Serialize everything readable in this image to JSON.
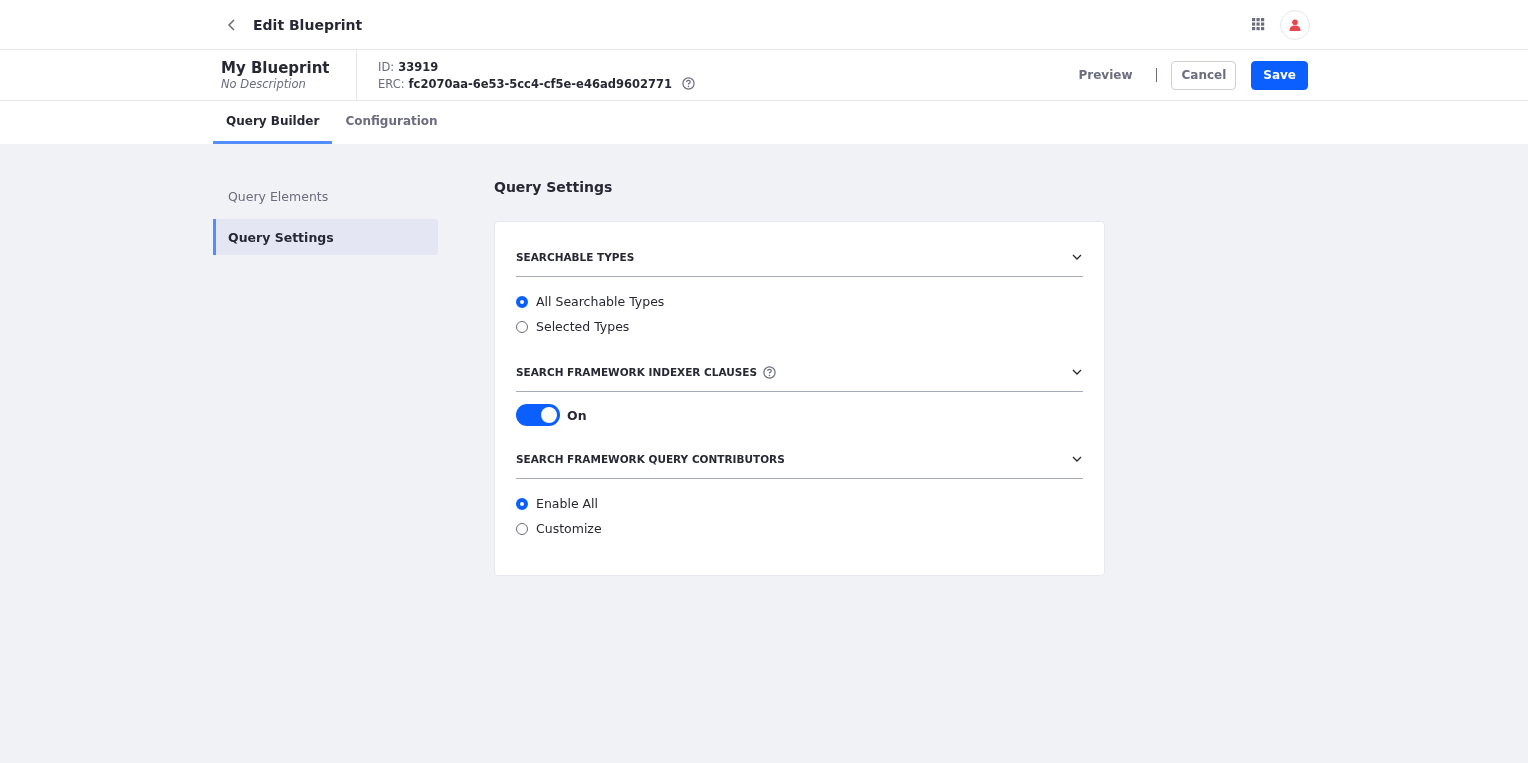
{
  "top_bar": {
    "title": "Edit Blueprint"
  },
  "header": {
    "name": "My Blueprint",
    "description": "No Description",
    "id_label": "ID:",
    "id_value": "33919",
    "erc_label": "ERC:",
    "erc_value": "fc2070aa-6e53-5cc4-cf5e-e46ad9602771",
    "preview": "Preview",
    "cancel": "Cancel",
    "save": "Save"
  },
  "tabs": [
    {
      "label": "Query Builder",
      "selected": true
    },
    {
      "label": "Configuration",
      "selected": false
    }
  ],
  "sidebar": {
    "items": [
      {
        "label": "Query Elements",
        "selected": false
      },
      {
        "label": "Query Settings",
        "selected": true
      }
    ]
  },
  "panel": {
    "title": "Query Settings",
    "sections": [
      {
        "title": "SEARCHABLE TYPES",
        "help": false,
        "expanded": true,
        "kind": "radio",
        "options": [
          {
            "label": "All Searchable Types",
            "selected": true
          },
          {
            "label": "Selected Types",
            "selected": false
          }
        ]
      },
      {
        "title": "SEARCH FRAMEWORK INDEXER CLAUSES",
        "help": true,
        "expanded": true,
        "kind": "toggle",
        "toggle": {
          "label": "On",
          "on": true
        }
      },
      {
        "title": "SEARCH FRAMEWORK QUERY CONTRIBUTORS",
        "help": false,
        "expanded": true,
        "kind": "radio",
        "options": [
          {
            "label": "Enable All",
            "selected": true
          },
          {
            "label": "Customize",
            "selected": false
          }
        ]
      }
    ]
  }
}
